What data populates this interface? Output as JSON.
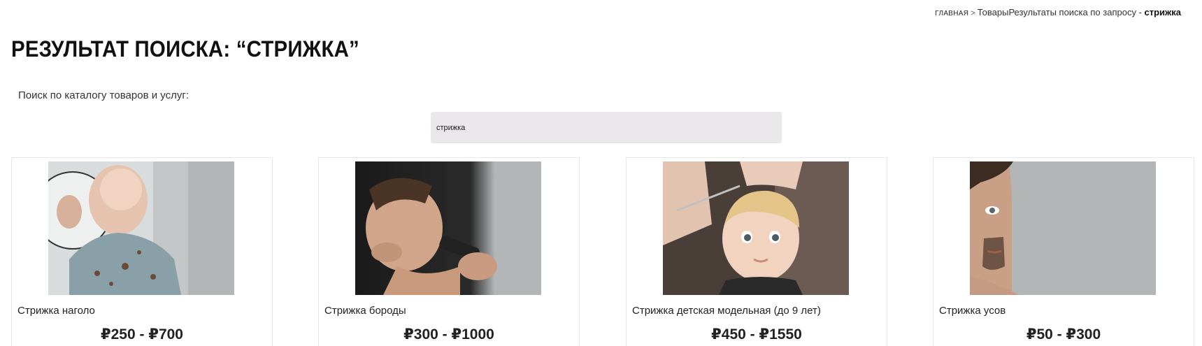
{
  "breadcrumb": {
    "home": "главная",
    "separator": ">",
    "section": "Товары",
    "results_prefix": "Результаты поиска по запросу - ",
    "query": "стрижка"
  },
  "page_title": "РЕЗУЛЬТАТ ПОИСКА: “СТРИЖКА”",
  "search": {
    "label": "Поиск по каталогу товаров и услуг:",
    "value": "стрижка"
  },
  "products": [
    {
      "name": "Стрижка наголо",
      "price": "₽250 - ₽700",
      "image": "bald-haircut-photo"
    },
    {
      "name": "Стрижка бороды",
      "price": "₽300 - ₽1000",
      "image": "beard-trim-photo"
    },
    {
      "name": "Стрижка детская модельная (до 9 лет)",
      "price": "₽450 - ₽1550",
      "image": "child-haircut-photo"
    },
    {
      "name": "Стрижка усов",
      "price": "₽50 - ₽300",
      "image": "mustache-trim-photo"
    }
  ],
  "colors": {
    "image_background": "#b2b6b6",
    "search_background": "#eae8ea"
  }
}
